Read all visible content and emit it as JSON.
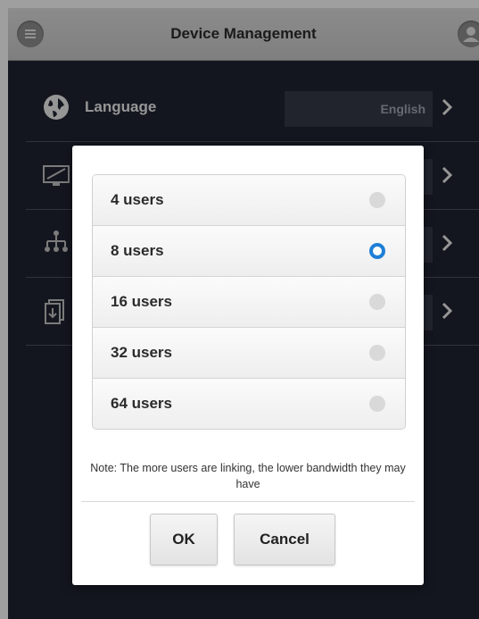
{
  "header": {
    "title": "Device Management"
  },
  "settings": [
    {
      "label": "Language",
      "value": "English",
      "icon": "globe-icon"
    },
    {
      "label": "",
      "value": "",
      "icon": "display-icon"
    },
    {
      "label": "",
      "value": "",
      "icon": "network-icon"
    },
    {
      "label": "",
      "value": "",
      "icon": "download-icon"
    }
  ],
  "dialog": {
    "options": [
      {
        "label": "4 users",
        "selected": false
      },
      {
        "label": "8 users",
        "selected": true
      },
      {
        "label": "16 users",
        "selected": false
      },
      {
        "label": "32 users",
        "selected": false
      },
      {
        "label": "64 users",
        "selected": false
      }
    ],
    "note": "Note: The more users are linking, the lower bandwidth they may have",
    "ok_label": "OK",
    "cancel_label": "Cancel"
  },
  "colors": {
    "accent": "#1f7fd6",
    "background": "#1f2230",
    "header": "#c9c9c9"
  }
}
